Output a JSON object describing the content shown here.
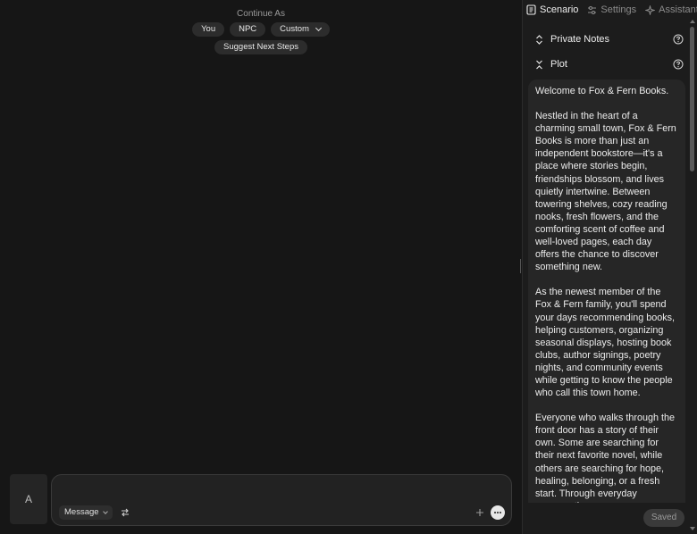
{
  "continue_as": {
    "label": "Continue As",
    "options": [
      "You",
      "NPC",
      "Custom"
    ],
    "suggest_label": "Suggest Next Steps"
  },
  "composer": {
    "avatar_letter": "A",
    "mode_label": "Message"
  },
  "panel": {
    "tabs": [
      {
        "label": "Scenario",
        "icon": "document-icon",
        "active": true
      },
      {
        "label": "Settings",
        "icon": "sliders-icon",
        "active": false
      },
      {
        "label": "Assistant",
        "icon": "sparkle-icon",
        "active": false
      }
    ],
    "sections": [
      {
        "label": "Private Notes",
        "icon": "expand-icon"
      },
      {
        "label": "Plot",
        "icon": "collapse-icon"
      }
    ],
    "plot_paragraphs": [
      "Welcome to Fox & Fern Books.",
      "Nestled in the heart of a charming small town, Fox & Fern Books is more than just an independent bookstore—it's a place where stories begin, friendships blossom, and lives quietly intertwine. Between towering shelves, cozy reading nooks, fresh flowers, and the comforting scent of coffee and well-loved pages, each day offers the chance to discover something new.",
      "As the newest member of the Fox & Fern family, you'll spend your days recommending books, helping customers, organizing seasonal displays, hosting book clubs, author signings, poetry nights, and community events while getting to know the people who call this town home.",
      "Everyone who walks through the front door has a story of their own. Some are searching for their next favorite novel, while others are searching for hope, healing, belonging, or a fresh start. Through everyday conversations,"
    ],
    "saved_label": "Saved"
  }
}
